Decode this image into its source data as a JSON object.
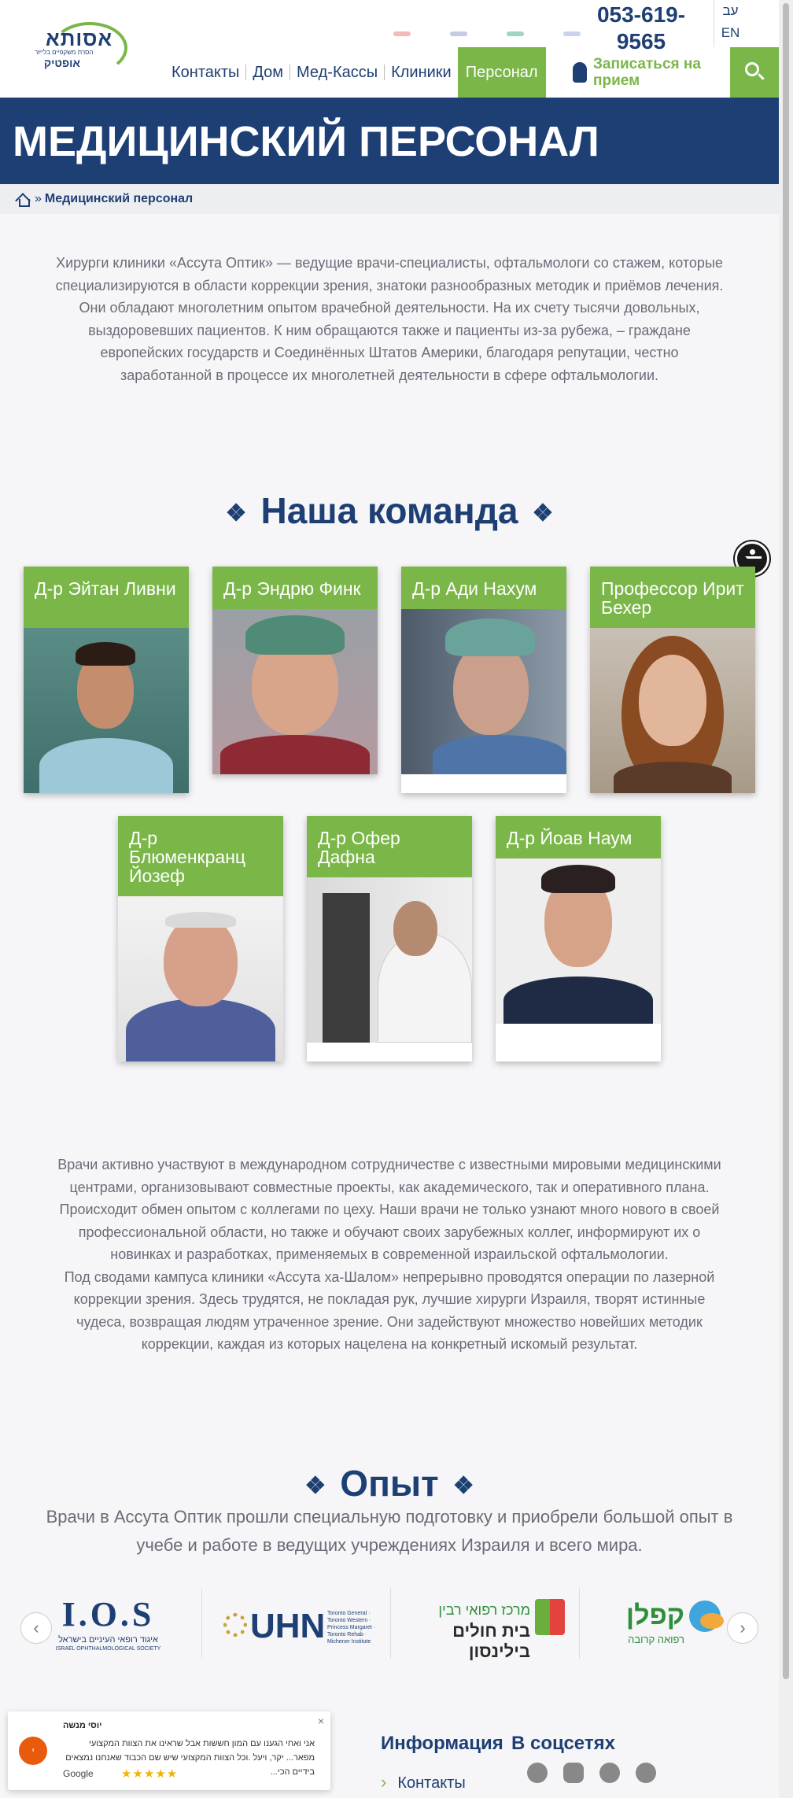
{
  "header": {
    "logo": {
      "line1": "אסותא",
      "line2": "אופטיק",
      "tagline": "הסרת משקפיים בלייזר"
    },
    "phone": "053-619-9565",
    "languages": [
      "עב",
      "EN"
    ],
    "nav": [
      {
        "label": "Контакты"
      },
      {
        "label": "Дом"
      },
      {
        "label": "Мед-Кассы"
      },
      {
        "label": "Клиники"
      },
      {
        "label": "Персонал",
        "active": true
      }
    ],
    "signup_label": "Записаться на прием",
    "accent": "#7ab648",
    "brand": "#1e3f74"
  },
  "banner": {
    "title": "МЕДИЦИНСКИЙ ПЕРСОНАЛ"
  },
  "breadcrumb": {
    "separator": "»",
    "current": "Медицинский персонал"
  },
  "intro": "Хирурги клиники «Ассута Оптик» — ведущие врачи-специалисты, офтальмологи со стажем, которые специализируются в области коррекции зрения, знатоки разнообразных методик и приёмов лечения.\nОни обладают многолетним опытом врачебной деятельности. На их счету тысячи довольных, выздоровевших пациентов. К ним обращаются также и пациенты из-за рубежа, – граждане европейских государств и Соединённых Штатов Америки, благодаря репутации, честно заработанной в процессе их многолетней деятельности в сфере офтальмологии.",
  "team": {
    "title": "Наша команда",
    "ornament": "❖",
    "doctors": [
      {
        "name": "Д-р Эйтан Ливни"
      },
      {
        "name": "Д-р Эндрю Финк"
      },
      {
        "name": "Д-р Ади Нахум"
      },
      {
        "name": "Профессор Ирит Бехер"
      },
      {
        "name": "Д-р Блюменкранц Йозеф"
      },
      {
        "name": "Д-р Офер Дафна"
      },
      {
        "name": "Д-р Йоав Наум"
      }
    ]
  },
  "body_text": "Врачи активно участвуют в международном сотрудничестве с известными мировыми медицинскими центрами, организовывают совместные проекты, как академического, так и оперативного плана. Происходит обмен опытом с коллегами по цеху. Наши врачи не только узнают много нового в своей профессиональной области, но также и обучают своих зарубежных коллег, информируют их о новинках и разработках, применяемых в современной израильской офтальмологии.\nПод сводами кампуса клиники «Ассута ха-Шалом» непрерывно проводятся операции по лазерной коррекции зрения. Здесь трудятся, не покладая рук, лучшие хирурги Израиля, творят истинные чудеса, возвращая людям утраченное зрение. Они задействуют множество новейших методик коррекции, каждая из которых нацелена на конкретный искомый результат.",
  "experience": {
    "title": "Опыт",
    "subtitle": "Врачи в Ассута Оптик прошли специальную подготовку и приобрели большой опыт в учебе и работе в ведущих учреждениях Израиля и всего мира.",
    "partners": [
      {
        "main": "I.O.S",
        "sub": "איגוד רופאי העיניים בישראל",
        "sub2": "ISRAEL OPHTHALMOLOGICAL SOCIETY"
      },
      {
        "main": "UHN",
        "sub": "Toronto General · Toronto Western · Princess Margaret · Toronto Rehab · Michener Institute"
      },
      {
        "main": "מרכז רפואי רבין",
        "sub": "בית חולים בילינסון"
      },
      {
        "main": "קפלן",
        "sub": "רפואה קרובה"
      }
    ],
    "prev": "‹",
    "next": "›"
  },
  "review": {
    "author": "יוסי מנשה",
    "text": "אני ואחי הגענו עם המון חששות אבל שראינו את הצוות המקצועי מפאר... יקר, ויעל .וכל הצוות המקצועי שיש שם הכבוד שאנחנו נמצאים בידיים הכי...",
    "source": "Google",
    "stars": "★★★★★",
    "rating": 5
  },
  "footer": {
    "info_title": "Информация",
    "social_title": "В соцсетях",
    "first_link": "Контакты",
    "social_icons": [
      "facebook-icon",
      "youtube-icon",
      "messenger-icon",
      "whatsapp-icon"
    ]
  }
}
